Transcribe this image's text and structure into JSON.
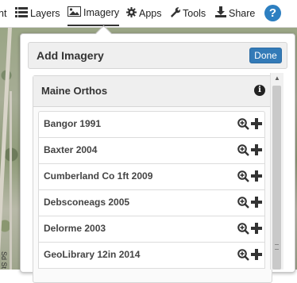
{
  "toolbar": {
    "items": [
      {
        "label": "nt",
        "icon": "partial-icon"
      },
      {
        "label": "Layers",
        "icon": "layers-icon"
      },
      {
        "label": "Imagery",
        "icon": "image-icon",
        "active": true
      },
      {
        "label": "Apps",
        "icon": "gear-icon"
      },
      {
        "label": "Tools",
        "icon": "wrench-icon"
      },
      {
        "label": "Share",
        "icon": "download-icon"
      }
    ],
    "help_label": "?"
  },
  "map": {
    "street_label": "Sd St"
  },
  "panel": {
    "title": "Add Imagery",
    "done_label": "Done",
    "group": {
      "title": "Maine Orthos",
      "info_label": "i",
      "items": [
        {
          "label": "Bangor 1991"
        },
        {
          "label": "Baxter 2004"
        },
        {
          "label": "Cumberland Co 1ft 2009"
        },
        {
          "label": "Debsconeags 2005"
        },
        {
          "label": "Delorme 2003"
        },
        {
          "label": "GeoLibrary 12in 2014"
        }
      ]
    }
  },
  "colors": {
    "accent": "#337ab7",
    "help": "#2d7fc1"
  }
}
